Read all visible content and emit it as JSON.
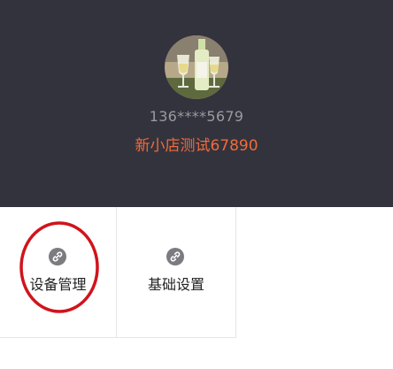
{
  "header": {
    "phone": "136****5679",
    "shop_name": "新小店测试67890"
  },
  "menu": {
    "items": [
      {
        "label": "设备管理",
        "icon": "link-icon"
      },
      {
        "label": "基础设置",
        "icon": "link-icon"
      }
    ]
  },
  "colors": {
    "header_bg": "#33333d",
    "shop_name": "#ef6b3a",
    "phone": "#9a9aa0",
    "annotation_circle": "#d0141c"
  }
}
